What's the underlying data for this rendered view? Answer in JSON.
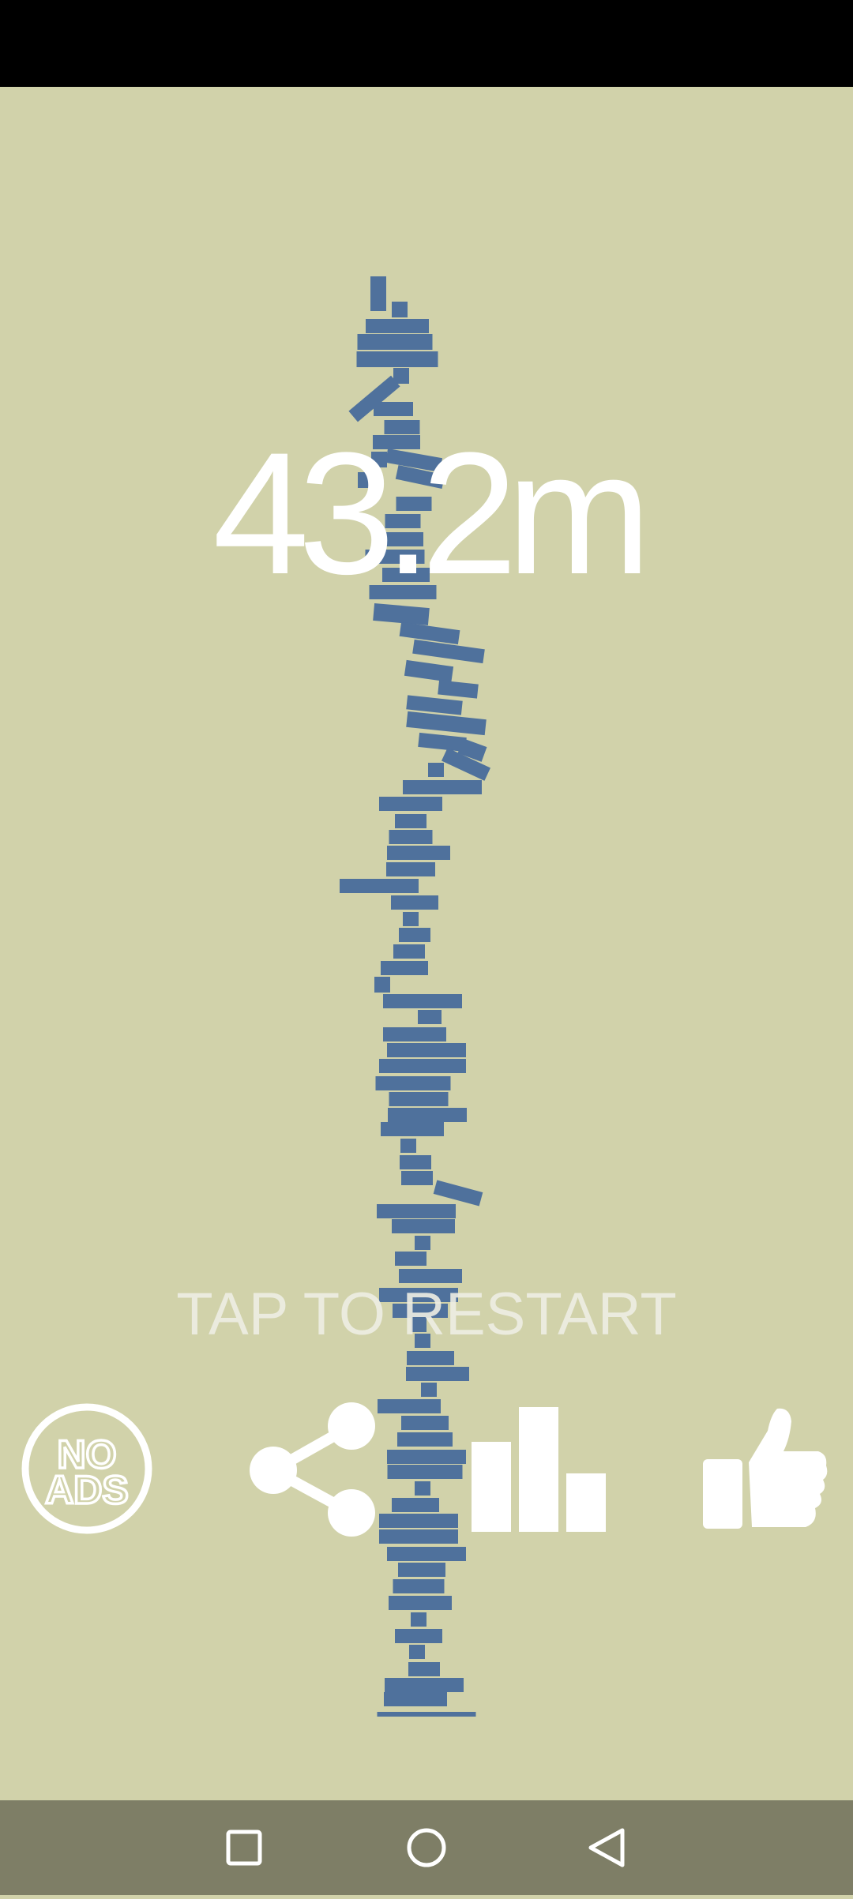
{
  "game": {
    "score": "43.2m",
    "restart_label": "TAP TO RESTART"
  },
  "buttons": {
    "no_ads_line1": "NO",
    "no_ads_line2": "ADS"
  },
  "icons": {
    "no_ads": "no-ads-icon",
    "share": "share-icon",
    "leaderboard": "leaderboard-icon",
    "like": "thumbs-up-icon",
    "nav_recents": "square-icon",
    "nav_home": "circle-icon",
    "nav_back": "triangle-back-icon"
  },
  "colors": {
    "background": "#d1d2aa",
    "block": "#4f719c",
    "text": "#ffffff",
    "nav_bar": "#7e7e66"
  }
}
